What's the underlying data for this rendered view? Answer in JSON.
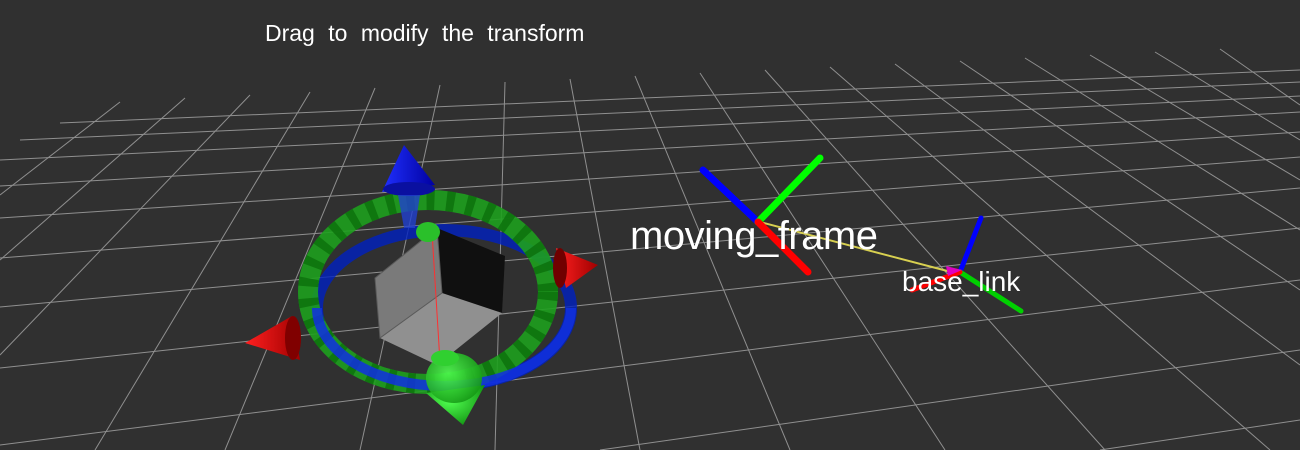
{
  "viewport": {
    "hint_text": "Drag to modify the transform",
    "background_color": "#303030",
    "grid_color": "#a0a0a0"
  },
  "frames": {
    "moving_frame": {
      "label": "moving_frame"
    },
    "base_link": {
      "label": "base_link"
    },
    "link_color": "#d8d050"
  },
  "axis_colors": {
    "x": "#ff0000",
    "y": "#00ff00",
    "z": "#0000ff"
  },
  "interactive_marker": {
    "box_color": "#808080",
    "ring_colors": [
      "#1ea01e",
      "#1a8f1a",
      "#0020c0"
    ]
  }
}
